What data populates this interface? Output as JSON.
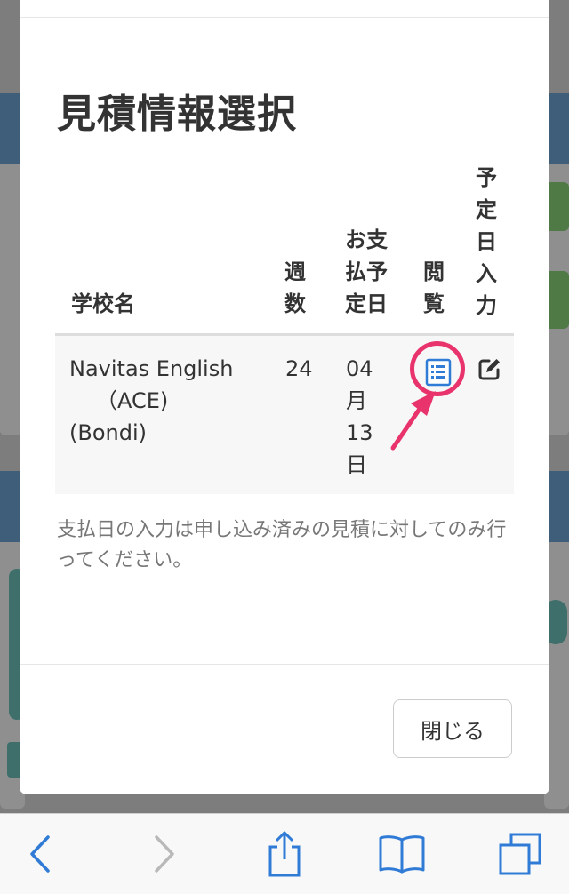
{
  "modal": {
    "title": "見積情報選択",
    "columns": {
      "school": "学校名",
      "weeks": [
        "週",
        "数"
      ],
      "payment_date": [
        "お支",
        "払予",
        "定日"
      ],
      "view": [
        "閲",
        "覧"
      ],
      "schedule_input": [
        "予",
        "定",
        "日",
        "入",
        "力"
      ]
    },
    "rows": [
      {
        "school": [
          "Navitas English",
          "（ACE)",
          "(Bondi)"
        ],
        "weeks": "24",
        "payment_date": [
          "04",
          "月",
          "13",
          "日"
        ],
        "view_icon": "list-document-icon",
        "edit_icon": "edit-pencil-icon"
      }
    ],
    "note": "支払日の入力は申し込み済みの見積に対してのみ行ってください。",
    "close_label": "閉じる"
  },
  "toolbar": {
    "icons": [
      "back-chevron-icon",
      "forward-chevron-icon",
      "share-icon",
      "bookmarks-icon",
      "tabs-icon"
    ]
  },
  "colors": {
    "accent_blue": "#2f7bd6",
    "highlight_pink": "#e8336d"
  }
}
